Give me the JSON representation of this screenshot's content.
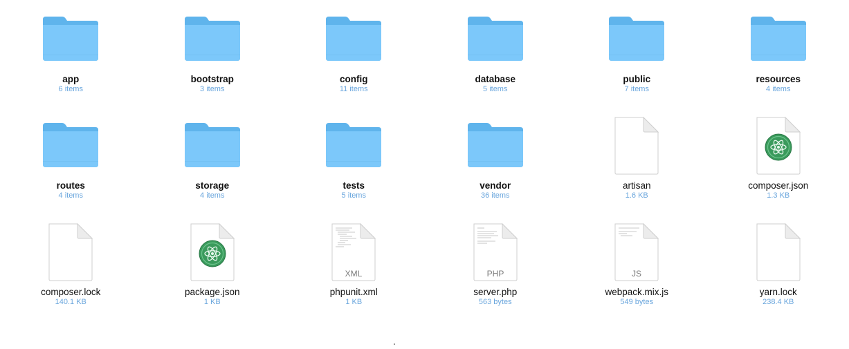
{
  "files": [
    {
      "name": "app",
      "meta": "6 items",
      "kind": "folder"
    },
    {
      "name": "bootstrap",
      "meta": "3 items",
      "kind": "folder"
    },
    {
      "name": "config",
      "meta": "11 items",
      "kind": "folder"
    },
    {
      "name": "database",
      "meta": "5 items",
      "kind": "folder"
    },
    {
      "name": "public",
      "meta": "7 items",
      "kind": "folder"
    },
    {
      "name": "resources",
      "meta": "4 items",
      "kind": "folder"
    },
    {
      "name": "routes",
      "meta": "4 items",
      "kind": "folder"
    },
    {
      "name": "storage",
      "meta": "4 items",
      "kind": "folder"
    },
    {
      "name": "tests",
      "meta": "5 items",
      "kind": "folder"
    },
    {
      "name": "vendor",
      "meta": "36 items",
      "kind": "folder"
    },
    {
      "name": "artisan",
      "meta": "1.6 KB",
      "kind": "document"
    },
    {
      "name": "composer.json",
      "meta": "1.3 KB",
      "kind": "atom-document"
    },
    {
      "name": "composer.lock",
      "meta": "140.1 KB",
      "kind": "document"
    },
    {
      "name": "package.json",
      "meta": "1 KB",
      "kind": "atom-document"
    },
    {
      "name": "phpunit.xml",
      "meta": "1 KB",
      "kind": "code-document",
      "badge": "XML"
    },
    {
      "name": "server.php",
      "meta": "563 bytes",
      "kind": "code-document",
      "badge": "PHP"
    },
    {
      "name": "webpack.mix.js",
      "meta": "549 bytes",
      "kind": "code-document",
      "badge": "JS"
    },
    {
      "name": "yarn.lock",
      "meta": "238.4 KB",
      "kind": "document"
    }
  ],
  "colors": {
    "folder_back": "#5fb4ec",
    "folder_front": "#7cc8fa",
    "item_meta": "#6aa6dd",
    "atom_green": "#3a9a5c"
  }
}
